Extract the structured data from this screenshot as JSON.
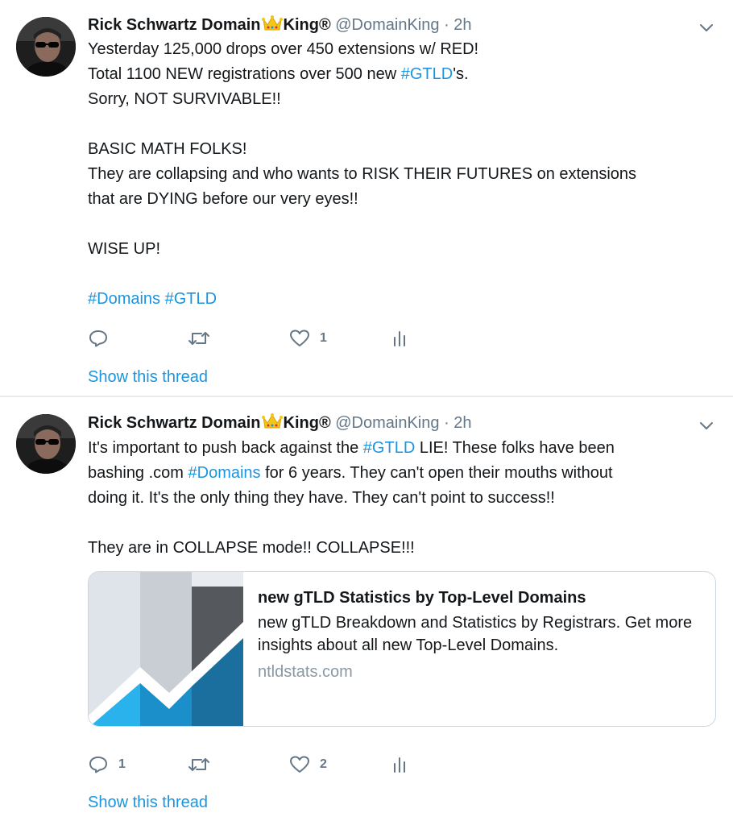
{
  "tweets": [
    {
      "author_name": "Rick Schwartz Domain",
      "author_name_suffix": "King®",
      "crown_icon": "crown-emoji",
      "handle": "@DomainKing",
      "separator": "·",
      "time": "2h",
      "text_parts": [
        {
          "t": "Yesterday 125,000 drops over 450 extensions w/ RED!\nTotal 1100 NEW registrations over 500 new "
        },
        {
          "t": "#GTLD",
          "tag": true
        },
        {
          "t": "'s.\nSorry, NOT SURVIVABLE!!\n\nBASIC MATH FOLKS!\nThey are collapsing and who wants to RISK THEIR FUTURES on extensions\nthat are DYING before our very eyes!!\n\nWISE UP!\n\n"
        },
        {
          "t": "#Domains",
          "tag": true
        },
        {
          "t": " "
        },
        {
          "t": "#GTLD",
          "tag": true
        }
      ],
      "reply_count": "",
      "retweet_count": "",
      "like_count": "1",
      "show_thread": "Show this thread"
    },
    {
      "author_name": "Rick Schwartz Domain",
      "author_name_suffix": "King®",
      "crown_icon": "crown-emoji",
      "handle": "@DomainKing",
      "separator": "·",
      "time": "2h",
      "text_parts": [
        {
          "t": "It's important to push back against the "
        },
        {
          "t": "#GTLD",
          "tag": true
        },
        {
          "t": " LIE! These folks have been\nbashing .com "
        },
        {
          "t": "#Domains",
          "tag": true
        },
        {
          "t": " for 6 years. They can't open their mouths without\ndoing it. It's the only thing they have. They can't point to success!!\n\nThey are in COLLAPSE mode!! COLLAPSE!!!"
        }
      ],
      "card": {
        "title": "new gTLD Statistics by Top-Level Domains",
        "description": "new gTLD Breakdown and Statistics by Registrars. Get more insights about all new Top-Level Domains.",
        "domain": "ntldstats.com"
      },
      "reply_count": "1",
      "retweet_count": "",
      "like_count": "2",
      "show_thread": "Show this thread"
    }
  ],
  "colors": {
    "text": "#14171a",
    "secondary": "#657786",
    "link": "#1b95e0",
    "border": "#e6ecf0"
  }
}
